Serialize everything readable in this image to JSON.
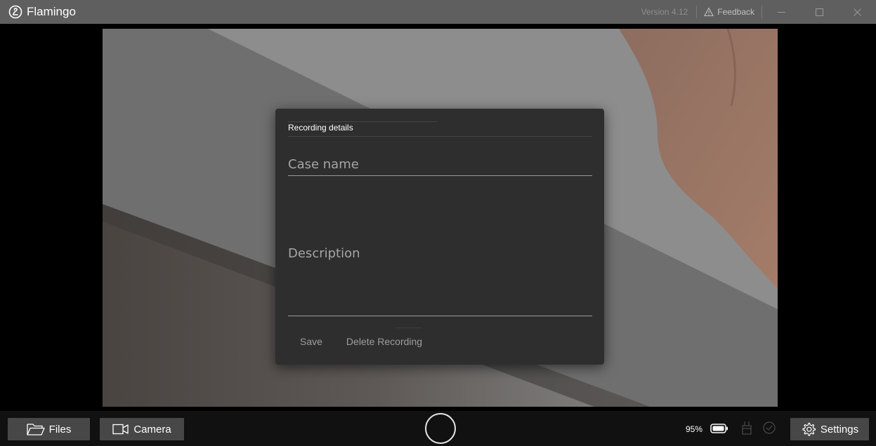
{
  "titlebar": {
    "app_title": "Flamingo",
    "version": "Version 4.12",
    "feedback_label": "Feedback"
  },
  "dialog": {
    "title": "Recording details",
    "case_name_placeholder": "Case name",
    "description_placeholder": "Description",
    "save_label": "Save",
    "delete_label": "Delete Recording"
  },
  "bottombar": {
    "files_label": "Files",
    "camera_label": "Camera",
    "battery_percent": "95%",
    "settings_label": "Settings"
  },
  "colors": {
    "titlebar_bg": "#5f5f5f",
    "dialog_bg": "#2e2e2e",
    "button_bg": "#474747",
    "bottombar_bg": "#111111"
  },
  "icons": [
    "flamingo-logo-icon",
    "warning-icon",
    "minimize-icon",
    "maximize-icon",
    "close-icon",
    "folder-icon",
    "camera-icon",
    "record-icon",
    "battery-icon",
    "dock-icon",
    "check-circle-icon",
    "gear-icon"
  ]
}
